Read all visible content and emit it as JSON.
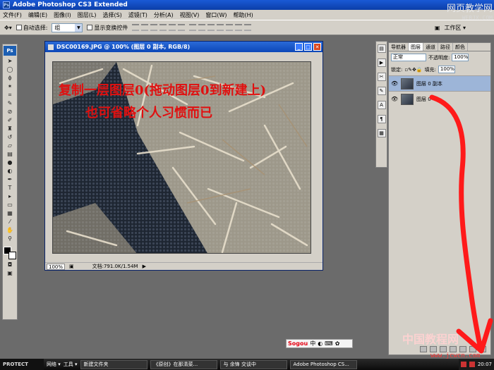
{
  "app": {
    "title": "Adobe Photoshop CS3 Extended",
    "ps_label": "Ps",
    "watermark_top": "网页教学网",
    "watermark_top_sub": "WEBJX.COM"
  },
  "menu": [
    "文件(F)",
    "编辑(E)",
    "图像(I)",
    "图层(L)",
    "选择(S)",
    "滤镜(T)",
    "分析(A)",
    "视图(V)",
    "窗口(W)",
    "帮助(H)"
  ],
  "options": {
    "auto_select_label": "自动选择:",
    "auto_select_value": "组",
    "show_transform_label": "显示变换控件",
    "workspace_label": "工作区 ▾"
  },
  "document": {
    "title": "DSC00169.JPG @ 100% (图层 0 副本, RGB/8)",
    "overlay_line1": "复制一层图层0(拖动图层0到新建上)",
    "overlay_line2": "也可省略个人习惯而已",
    "zoom": "100%",
    "doc_info": "文档:791.0K/1.54M"
  },
  "layers_panel": {
    "tabs": [
      "导航器",
      "图层",
      "通道",
      "路径",
      "颜色"
    ],
    "active_tab": "图层",
    "blend_mode": "正常",
    "opacity_label": "不透明度:",
    "opacity_value": "100%",
    "lock_label": "锁定:",
    "fill_label": "填充:",
    "fill_value": "100%",
    "layers": [
      {
        "name": "图层 0 副本"
      },
      {
        "name": "图层 0"
      }
    ]
  },
  "ime": {
    "brand": "Sogou",
    "mode": "中"
  },
  "bottom_watermark": "中国教程网",
  "bottom_watermark_sub": "www.jcwcn.com",
  "taskbar": {
    "start": "PROTECT",
    "quick1": "网络 ▾",
    "quick2": "工具 ▾",
    "buttons": [
      "新建文件夹",
      "《原创》在那清菜...",
      "与 余锋 交谈中",
      "Adobe Photoshop CS..."
    ],
    "clock": "20:07"
  },
  "colors": {
    "annotation": "#e01010",
    "titlebar": "#0b3ea8"
  }
}
